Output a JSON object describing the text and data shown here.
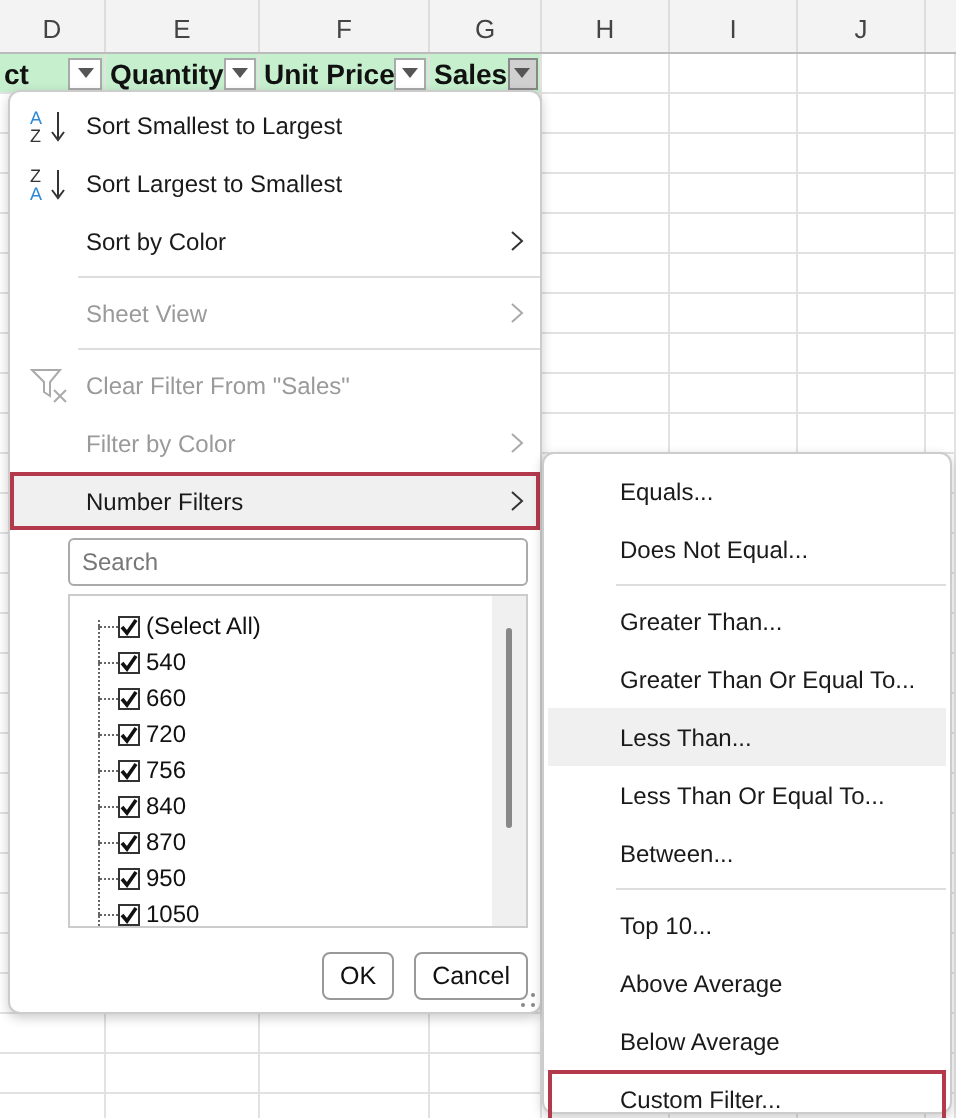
{
  "columns": [
    {
      "letter": "D"
    },
    {
      "letter": "E"
    },
    {
      "letter": "F"
    },
    {
      "letter": "G"
    },
    {
      "letter": "H"
    },
    {
      "letter": "I"
    },
    {
      "letter": "J"
    }
  ],
  "header_cells": [
    {
      "text": "ct",
      "filter_active": false
    },
    {
      "text": "Quantity",
      "filter_active": false
    },
    {
      "text": "Unit Price",
      "filter_active": false
    },
    {
      "text": "Sales",
      "filter_active": true
    }
  ],
  "filter_menu": {
    "items": [
      {
        "kind": "sort_ascending",
        "icon_letters": [
          "A",
          "Z"
        ],
        "label": "Sort Smallest to Largest",
        "disabled": false,
        "submenu": false,
        "highlighted": false
      },
      {
        "kind": "sort_descending",
        "icon_letters": [
          "Z",
          "A"
        ],
        "label": "Sort Largest to Smallest",
        "disabled": false,
        "submenu": false,
        "highlighted": false
      },
      {
        "kind": "command",
        "label": "Sort by Color",
        "disabled": false,
        "submenu": true,
        "highlighted": false
      },
      {
        "kind": "separator"
      },
      {
        "kind": "command",
        "label": "Sheet View",
        "disabled": true,
        "submenu": true,
        "highlighted": false
      },
      {
        "kind": "separator"
      },
      {
        "kind": "clear_filter",
        "label": "Clear Filter From \"Sales\"",
        "disabled": true,
        "submenu": false,
        "highlighted": false
      },
      {
        "kind": "command",
        "label": "Filter by Color",
        "disabled": true,
        "submenu": true,
        "highlighted": false
      },
      {
        "kind": "command",
        "label": "Number Filters",
        "disabled": false,
        "submenu": true,
        "highlighted": true
      }
    ],
    "search": {
      "placeholder": "Search"
    },
    "values": [
      {
        "label": "(Select All)",
        "checked": true
      },
      {
        "label": "540",
        "checked": true
      },
      {
        "label": "660",
        "checked": true
      },
      {
        "label": "720",
        "checked": true
      },
      {
        "label": "756",
        "checked": true
      },
      {
        "label": "840",
        "checked": true
      },
      {
        "label": "870",
        "checked": true
      },
      {
        "label": "950",
        "checked": true
      },
      {
        "label": "1050",
        "checked": true
      }
    ],
    "buttons": [
      "OK",
      "Cancel"
    ]
  },
  "number_filters_menu": {
    "items": [
      {
        "kind": "command",
        "label": "Equals...",
        "highlighted": false
      },
      {
        "kind": "command",
        "label": "Does Not Equal...",
        "highlighted": false
      },
      {
        "kind": "separator"
      },
      {
        "kind": "command",
        "label": "Greater Than...",
        "highlighted": false
      },
      {
        "kind": "command",
        "label": "Greater Than Or Equal To...",
        "highlighted": false
      },
      {
        "kind": "command",
        "label": "Less Than...",
        "highlighted": true
      },
      {
        "kind": "command",
        "label": "Less Than Or Equal To...",
        "highlighted": false
      },
      {
        "kind": "command",
        "label": "Between...",
        "highlighted": false
      },
      {
        "kind": "separator"
      },
      {
        "kind": "command",
        "label": "Top 10...",
        "highlighted": false
      },
      {
        "kind": "command",
        "label": "Above Average",
        "highlighted": false
      },
      {
        "kind": "command",
        "label": "Below Average",
        "highlighted": false
      },
      {
        "kind": "outlined",
        "label": "Custom Filter...",
        "highlighted": false
      }
    ]
  }
}
